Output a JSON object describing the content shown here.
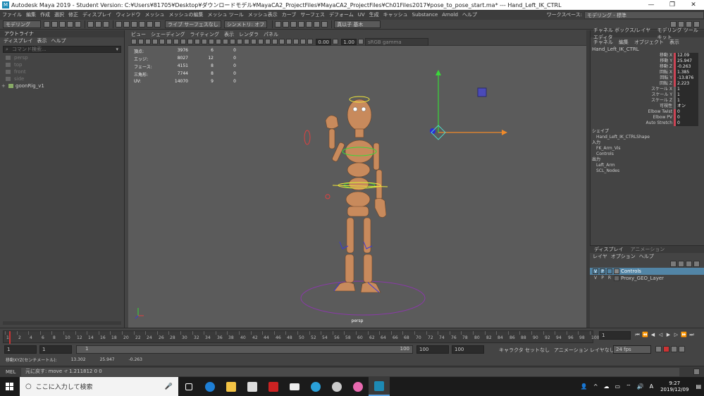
{
  "window": {
    "title": "Autodesk Maya 2019 - Student Version: C:¥Users¥81705¥Desktop¥ダウンロードモデル¥MayaCA2_ProjectFiles¥MayaCA2_ProjectFiles¥Ch01Files2017¥pose_to_pose_start.ma*  ---  Hand_Left_IK_CTRL",
    "min_icon": "—",
    "max_icon": "❐",
    "close_icon": "✕"
  },
  "menubar": {
    "items": [
      "ファイル",
      "編集",
      "作成",
      "選択",
      "修正",
      "ディスプレイ",
      "ウィンドウ",
      "メッシュ",
      "メッシュの編集",
      "メッシュ ツール",
      "メッシュ表示",
      "カーブ",
      "サーフェス",
      "デフォーム",
      "UV",
      "生成",
      "キャッシュ",
      "Substance",
      "Arnold",
      "ヘルプ"
    ],
    "workspace_label": "ワークスペース:",
    "workspace_value": "モデリング - 標準"
  },
  "toolbar": {
    "mode": "モデリング",
    "live_surface": "ライブ サーフェスなし",
    "symmetry": "シンメトリ: オフ",
    "user": "真以子 基木"
  },
  "outliner": {
    "title": "アウトライナ",
    "menu": [
      "ディスプレイ",
      "表示",
      "ヘルプ"
    ],
    "search_placeholder": "コマンド検索...",
    "items": [
      "persp",
      "top",
      "front",
      "side"
    ],
    "root_item": "goonRig_v1"
  },
  "viewport": {
    "menu": [
      "ビュー",
      "シェーディング",
      "ライティング",
      "表示",
      "レンダラ",
      "パネル"
    ],
    "exposure": "0.00",
    "gamma": "1.00",
    "color_space": "sRGB gamma",
    "hud": [
      {
        "label": "頂点:",
        "v1": "3976",
        "v2": "6",
        "v3": "0"
      },
      {
        "label": "エッジ:",
        "v1": "8027",
        "v2": "12",
        "v3": "0"
      },
      {
        "label": "フェース:",
        "v1": "4151",
        "v2": "8",
        "v3": "0"
      },
      {
        "label": "三角形:",
        "v1": "7744",
        "v2": "8",
        "v3": "0"
      },
      {
        "label": "UV:",
        "v1": "14070",
        "v2": "9",
        "v3": "0"
      }
    ],
    "camera_label": "persp"
  },
  "channelbox": {
    "tabs": [
      "チャネル ボックス/レイヤ エディタ",
      "モデリング ツールキット"
    ],
    "menu": [
      "チャネル",
      "編集",
      "オブジェクト",
      "表示"
    ],
    "object": "Hand_Left_IK_CTRL",
    "attributes": [
      {
        "name": "移動 X",
        "value": "12.09"
      },
      {
        "name": "移動 Y",
        "value": "25.947"
      },
      {
        "name": "移動 Z",
        "value": "-0.263"
      },
      {
        "name": "回転 X",
        "value": "1.385"
      },
      {
        "name": "回転 Y",
        "value": "-13.876"
      },
      {
        "name": "回転 Z",
        "value": "2.223"
      },
      {
        "name": "スケール X",
        "value": "1"
      },
      {
        "name": "スケール Y",
        "value": "1"
      },
      {
        "name": "スケール Z",
        "value": "1"
      },
      {
        "name": "可視性",
        "value": "オン"
      },
      {
        "name": "Elbow Twist",
        "value": "0"
      },
      {
        "name": "Elbow PV",
        "value": "0"
      },
      {
        "name": "Auto Stretch",
        "value": "0"
      }
    ],
    "shapes_header": "シェイプ",
    "shape": "Hand_Left_IK_CTRLShape",
    "inputs_header": "入力",
    "inputs": [
      "FK_Arm_Vis",
      "Controls"
    ],
    "outputs_header": "出力",
    "outputs": [
      "Left_Arm",
      "SCL_Nodes"
    ]
  },
  "layers": {
    "tabs": [
      "ディスプレイ",
      "アニメーション"
    ],
    "menu": [
      "レイヤ",
      "オプション",
      "ヘルプ"
    ],
    "rows": [
      {
        "v": "V",
        "p": "P",
        "r": "",
        "name": "Controls"
      },
      {
        "v": "V",
        "p": "P",
        "r": "R",
        "name": "Proxy_GEO_Layer"
      }
    ]
  },
  "timeline": {
    "ticks": [
      "1",
      "2",
      "4",
      "6",
      "8",
      "10",
      "12",
      "14",
      "16",
      "18",
      "20",
      "22",
      "24",
      "26",
      "28",
      "30",
      "32",
      "34",
      "36",
      "38",
      "40",
      "42",
      "44",
      "46",
      "48",
      "50",
      "52",
      "54",
      "56",
      "58",
      "60",
      "62",
      "64",
      "66",
      "68",
      "70",
      "72",
      "74",
      "76",
      "78",
      "80",
      "82",
      "84",
      "86",
      "88",
      "90",
      "92",
      "94",
      "96",
      "98",
      "100"
    ],
    "current_frame": "1"
  },
  "range": {
    "start": "1",
    "playback_start": "1",
    "slider_start": "1",
    "slider_end": "100",
    "playback_end": "100",
    "end": "100",
    "character_set": "キャラクタ セットなし",
    "anim_layer": "アニメーション レイヤなし",
    "fps": "24 fps"
  },
  "status": {
    "label": "移動XYZ(センチメートル):",
    "x": "13.302",
    "y": "25.947",
    "z": "-0.263"
  },
  "cmdline": {
    "lang": "MEL",
    "result": "元に戻す: move -r 1.211812 0 0"
  },
  "taskbar": {
    "search_placeholder": "ここに入力して検索",
    "time": "9:27",
    "date": "2019/12/09"
  },
  "colors": {
    "accent": "#5285a6",
    "body_skin": "#c88a5c",
    "ctrl_yellow": "#f1e93a",
    "ctrl_red": "#e04040",
    "ctrl_blue": "#3a3ad8",
    "ctrl_green": "#3ad83a",
    "ctrl_purple": "#8a3aa8"
  }
}
